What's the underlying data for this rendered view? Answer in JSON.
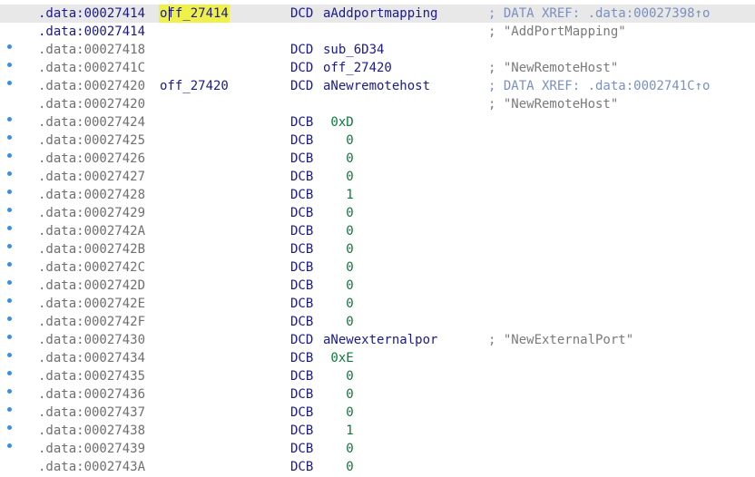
{
  "listing": {
    "colors": {
      "address": "#6f6f6f",
      "name": "#1a1a8c",
      "number": "#0a7a3a",
      "comment": "#7a7a7a",
      "xref": "#7a90c0",
      "highlight": "#f0f04a",
      "gutter_dot": "#3c8fe0",
      "current_line": "#e8e8e8"
    },
    "rows": [
      {
        "addr": ".data:00027414",
        "label": "off_27414",
        "mnemonic": "DCD",
        "operand": "aAddportmapping",
        "comment": "; DATA XREF: .data:00027398↑o"
      },
      {
        "addr": ".data:00027414",
        "label": "",
        "mnemonic": "",
        "operand": "",
        "comment": "; \"AddPortMapping\""
      },
      {
        "addr": ".data:00027418",
        "label": "",
        "mnemonic": "DCD",
        "operand": "sub_6D34",
        "comment": ""
      },
      {
        "addr": ".data:0002741C",
        "label": "",
        "mnemonic": "DCD",
        "operand": "off_27420",
        "comment": "; \"NewRemoteHost\""
      },
      {
        "addr": ".data:00027420",
        "label": "off_27420",
        "mnemonic": "DCD",
        "operand": "aNewremotehost",
        "comment": "; DATA XREF: .data:0002741C↑o"
      },
      {
        "addr": ".data:00027420",
        "label": "",
        "mnemonic": "",
        "operand": "",
        "comment": "; \"NewRemoteHost\""
      },
      {
        "addr": ".data:00027424",
        "label": "",
        "mnemonic": "DCB",
        "operand": " 0xD",
        "comment": ""
      },
      {
        "addr": ".data:00027425",
        "label": "",
        "mnemonic": "DCB",
        "operand": "   0",
        "comment": ""
      },
      {
        "addr": ".data:00027426",
        "label": "",
        "mnemonic": "DCB",
        "operand": "   0",
        "comment": ""
      },
      {
        "addr": ".data:00027427",
        "label": "",
        "mnemonic": "DCB",
        "operand": "   0",
        "comment": ""
      },
      {
        "addr": ".data:00027428",
        "label": "",
        "mnemonic": "DCB",
        "operand": "   1",
        "comment": ""
      },
      {
        "addr": ".data:00027429",
        "label": "",
        "mnemonic": "DCB",
        "operand": "   0",
        "comment": ""
      },
      {
        "addr": ".data:0002742A",
        "label": "",
        "mnemonic": "DCB",
        "operand": "   0",
        "comment": ""
      },
      {
        "addr": ".data:0002742B",
        "label": "",
        "mnemonic": "DCB",
        "operand": "   0",
        "comment": ""
      },
      {
        "addr": ".data:0002742C",
        "label": "",
        "mnemonic": "DCB",
        "operand": "   0",
        "comment": ""
      },
      {
        "addr": ".data:0002742D",
        "label": "",
        "mnemonic": "DCB",
        "operand": "   0",
        "comment": ""
      },
      {
        "addr": ".data:0002742E",
        "label": "",
        "mnemonic": "DCB",
        "operand": "   0",
        "comment": ""
      },
      {
        "addr": ".data:0002742F",
        "label": "",
        "mnemonic": "DCB",
        "operand": "   0",
        "comment": ""
      },
      {
        "addr": ".data:00027430",
        "label": "",
        "mnemonic": "DCD",
        "operand": "aNewexternalpor",
        "comment": "; \"NewExternalPort\""
      },
      {
        "addr": ".data:00027434",
        "label": "",
        "mnemonic": "DCB",
        "operand": " 0xE",
        "comment": ""
      },
      {
        "addr": ".data:00027435",
        "label": "",
        "mnemonic": "DCB",
        "operand": "   0",
        "comment": ""
      },
      {
        "addr": ".data:00027436",
        "label": "",
        "mnemonic": "DCB",
        "operand": "   0",
        "comment": ""
      },
      {
        "addr": ".data:00027437",
        "label": "",
        "mnemonic": "DCB",
        "operand": "   0",
        "comment": ""
      },
      {
        "addr": ".data:00027438",
        "label": "",
        "mnemonic": "DCB",
        "operand": "   1",
        "comment": ""
      },
      {
        "addr": ".data:00027439",
        "label": "",
        "mnemonic": "DCB",
        "operand": "   0",
        "comment": ""
      },
      {
        "addr": ".data:0002743A",
        "label": "",
        "mnemonic": "DCB",
        "operand": "   0",
        "comment": ""
      }
    ]
  }
}
